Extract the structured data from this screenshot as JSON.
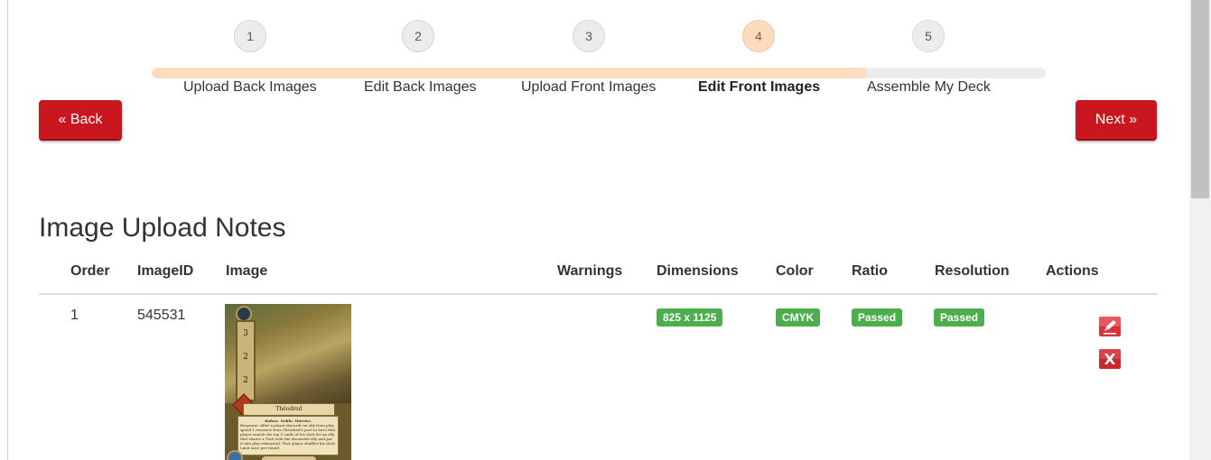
{
  "wizard": {
    "progress": 0.8,
    "steps": [
      {
        "number": "1",
        "label": "Upload Back Images",
        "active": false
      },
      {
        "number": "2",
        "label": "Edit Back Images",
        "active": false
      },
      {
        "number": "3",
        "label": "Upload Front Images",
        "active": false
      },
      {
        "number": "4",
        "label": "Edit Front Images",
        "active": true
      },
      {
        "number": "5",
        "label": "Assemble My Deck",
        "active": false
      }
    ]
  },
  "nav": {
    "back_label": "« Back",
    "next_label": "Next »"
  },
  "section": {
    "title": "Image Upload Notes"
  },
  "table": {
    "columns": [
      "Order",
      "ImageID",
      "Image",
      "Warnings",
      "Dimensions",
      "Color",
      "Ratio",
      "Resolution",
      "Actions"
    ],
    "rows": [
      {
        "order": "1",
        "image_id": "545531",
        "warnings": "",
        "dimensions": "825 x 1125",
        "color": "CMYK",
        "ratio": "Passed",
        "resolution": "Passed",
        "thumbnail": {
          "stats": [
            "3",
            "2",
            "2"
          ],
          "name": "Théodred",
          "traits": "Rohan. Noble. Warrior.",
          "text": "Response: After a player discards an ally from play, spend 1 resource from Théodred's pool to have that player search the top 5 cards of his deck for an ally that shares a Trait with the discarded ally and put it into play exhausted. That player shuffles his deck. Limit once per round."
        }
      }
    ]
  },
  "colors": {
    "accent_red": "#c9161f",
    "badge_green": "#4cae4c",
    "wizard_active": "#fbdcbf"
  },
  "icons": {
    "edit": "edit-icon",
    "delete": "delete-icon"
  }
}
